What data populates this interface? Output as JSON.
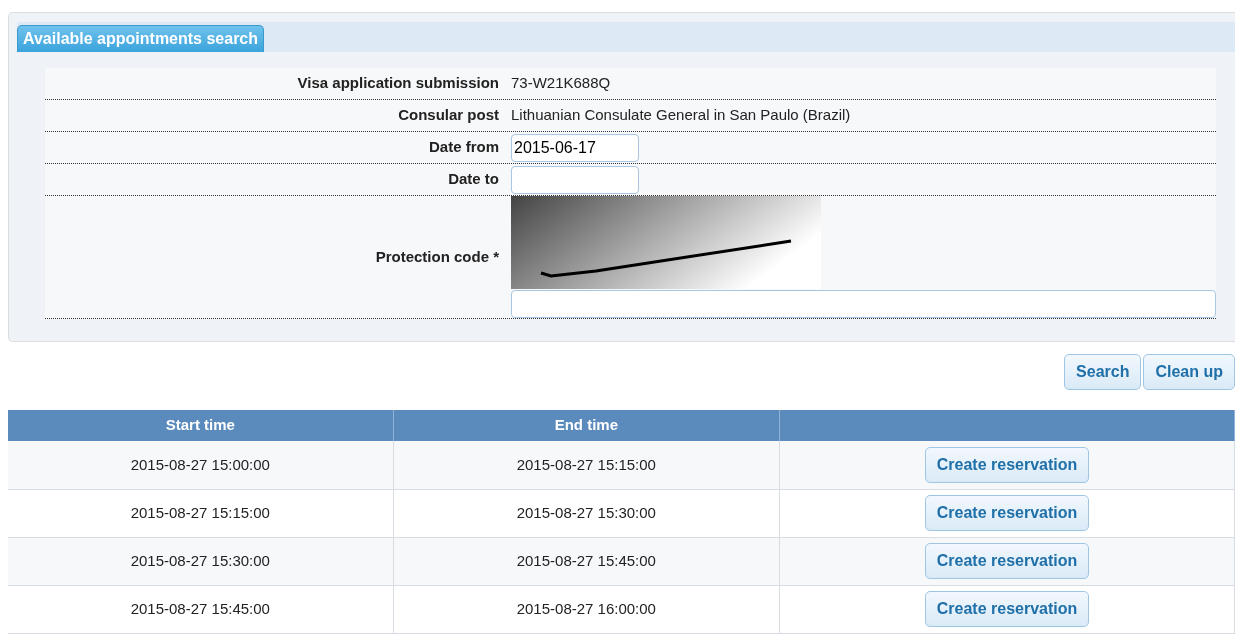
{
  "tab": {
    "label": "Available appointments search",
    "selected": true
  },
  "form": [
    {
      "kind": "text",
      "label": "Visa application submission",
      "value": "73-W21K688Q"
    },
    {
      "kind": "text",
      "label": "Consular post",
      "value": "Lithuanian Consulate General in San Paulo (Brazil)"
    },
    {
      "kind": "date",
      "label": "Date from",
      "value": "2015-06-17"
    },
    {
      "kind": "date",
      "label": "Date to"
    },
    {
      "kind": "captcha",
      "label": "Protection code *"
    }
  ],
  "buttons": [
    "Search",
    "Clean up"
  ],
  "table": {
    "columns": [
      "Start time",
      "End time",
      null
    ],
    "rows": [
      {
        "start": "2015-08-27 15:00:00",
        "end": "2015-08-27 15:15:00",
        "action": "Create reservation"
      },
      {
        "start": "2015-08-27 15:15:00",
        "end": "2015-08-27 15:30:00",
        "action": "Create reservation"
      },
      {
        "start": "2015-08-27 15:30:00",
        "end": "2015-08-27 15:45:00",
        "action": "Create reservation"
      },
      {
        "start": "2015-08-27 15:45:00",
        "end": "2015-08-27 16:00:00",
        "action": "Create reservation"
      }
    ]
  }
}
